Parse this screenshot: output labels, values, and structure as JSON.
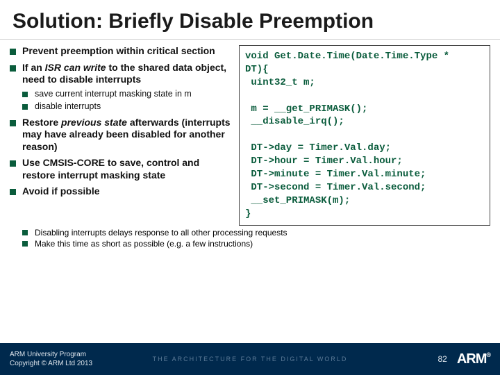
{
  "title": "Solution: Briefly Disable Preemption",
  "bullets": {
    "b1_a": "Prevent preemption within critical section",
    "b2_a": "If an ",
    "b2_b": "ISR can write",
    "b2_c": " to the shared data object, need to disable interrupts",
    "b2_sub1": "save current interrupt masking state in m",
    "b2_sub2": "disable interrupts",
    "b3_a": "Restore ",
    "b3_b": "previous state",
    "b3_c": " afterwards (interrupts may have already been disabled for another reason)",
    "b4": "Use CMSIS-CORE to save, control and restore interrupt masking state",
    "b5": "Avoid if possible",
    "sub1": "Disabling interrupts delays response to all other processing requests",
    "sub2": "Make this time as short as possible (e.g. a few instructions)"
  },
  "code": "void Get.Date.Time(Date.Time.Type *\nDT){\n uint32_t m;\n\n m = __get_PRIMASK();\n __disable_irq();\n\n DT->day = Timer.Val.day;\n DT->hour = Timer.Val.hour;\n DT->minute = Timer.Val.minute;\n DT->second = Timer.Val.second;\n __set_PRIMASK(m);\n}",
  "footer": {
    "line1": "ARM University Program",
    "line2": "Copyright © ARM Ltd 2013",
    "tagline": "THE ARCHITECTURE FOR THE DIGITAL WORLD",
    "page": "82",
    "logo": "ARM"
  }
}
